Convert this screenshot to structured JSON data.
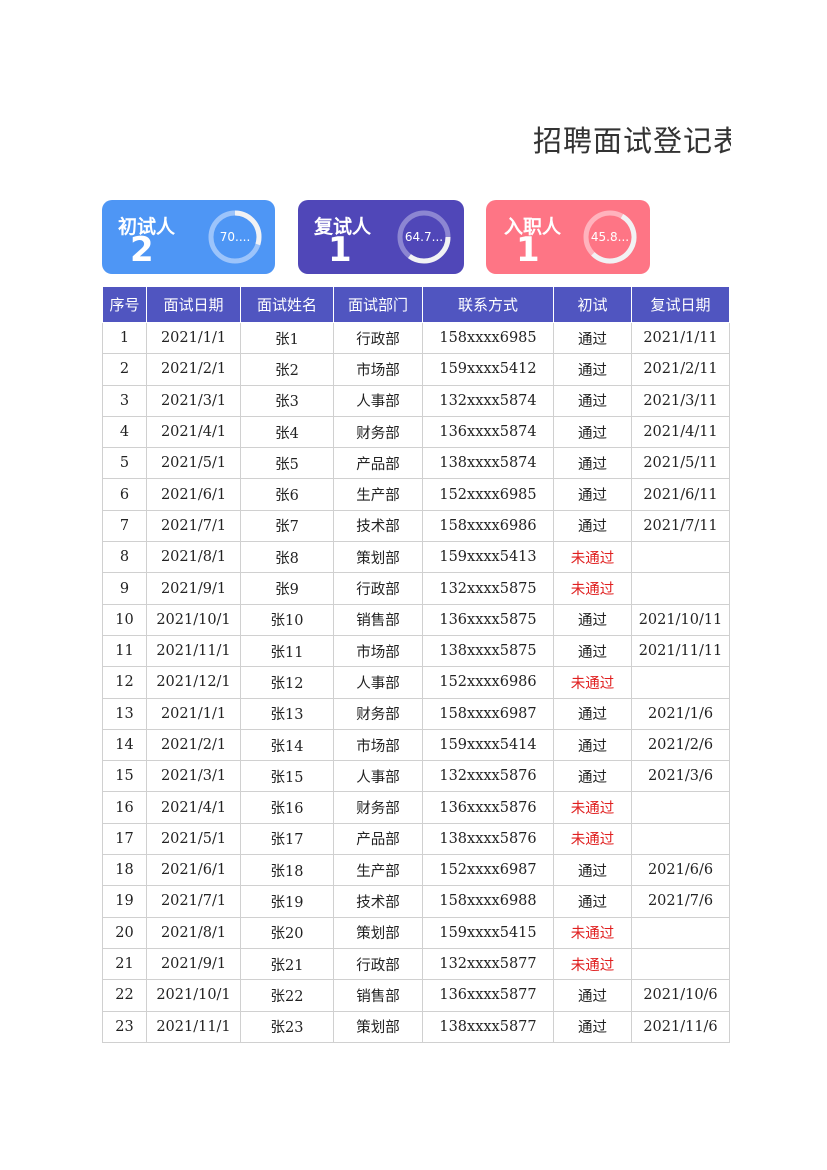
{
  "title": "招聘面试登记表",
  "cards": [
    {
      "label": "初试人",
      "count": "2",
      "ring_text": "70....",
      "percent": 70,
      "bg": "#4e96f5",
      "ring_light": "#9cc4fb"
    },
    {
      "label": "复试人",
      "count": "1",
      "ring_text": "64.7...",
      "percent": 64.7,
      "bg": "#5047b8",
      "ring_light": "#8c86d2"
    },
    {
      "label": "入职人",
      "count": "1",
      "ring_text": "45.8...",
      "percent": 45.8,
      "bg": "#fe7585",
      "ring_light": "#ffb3bd"
    }
  ],
  "table": {
    "headers": [
      "序号",
      "面试日期",
      "面试姓名",
      "面试部门",
      "联系方式",
      "初试",
      "复试日期"
    ],
    "rows": [
      [
        "1",
        "2021/1/1",
        "张1",
        "行政部",
        "158xxxx6985",
        "通过",
        "2021/1/11"
      ],
      [
        "2",
        "2021/2/1",
        "张2",
        "市场部",
        "159xxxx5412",
        "通过",
        "2021/2/11"
      ],
      [
        "3",
        "2021/3/1",
        "张3",
        "人事部",
        "132xxxx5874",
        "通过",
        "2021/3/11"
      ],
      [
        "4",
        "2021/4/1",
        "张4",
        "财务部",
        "136xxxx5874",
        "通过",
        "2021/4/11"
      ],
      [
        "5",
        "2021/5/1",
        "张5",
        "产品部",
        "138xxxx5874",
        "通过",
        "2021/5/11"
      ],
      [
        "6",
        "2021/6/1",
        "张6",
        "生产部",
        "152xxxx6985",
        "通过",
        "2021/6/11"
      ],
      [
        "7",
        "2021/7/1",
        "张7",
        "技术部",
        "158xxxx6986",
        "通过",
        "2021/7/11"
      ],
      [
        "8",
        "2021/8/1",
        "张8",
        "策划部",
        "159xxxx5413",
        "未通过",
        ""
      ],
      [
        "9",
        "2021/9/1",
        "张9",
        "行政部",
        "132xxxx5875",
        "未通过",
        ""
      ],
      [
        "10",
        "2021/10/1",
        "张10",
        "销售部",
        "136xxxx5875",
        "通过",
        "2021/10/11"
      ],
      [
        "11",
        "2021/11/1",
        "张11",
        "市场部",
        "138xxxx5875",
        "通过",
        "2021/11/11"
      ],
      [
        "12",
        "2021/12/1",
        "张12",
        "人事部",
        "152xxxx6986",
        "未通过",
        ""
      ],
      [
        "13",
        "2021/1/1",
        "张13",
        "财务部",
        "158xxxx6987",
        "通过",
        "2021/1/6"
      ],
      [
        "14",
        "2021/2/1",
        "张14",
        "市场部",
        "159xxxx5414",
        "通过",
        "2021/2/6"
      ],
      [
        "15",
        "2021/3/1",
        "张15",
        "人事部",
        "132xxxx5876",
        "通过",
        "2021/3/6"
      ],
      [
        "16",
        "2021/4/1",
        "张16",
        "财务部",
        "136xxxx5876",
        "未通过",
        ""
      ],
      [
        "17",
        "2021/5/1",
        "张17",
        "产品部",
        "138xxxx5876",
        "未通过",
        ""
      ],
      [
        "18",
        "2021/6/1",
        "张18",
        "生产部",
        "152xxxx6987",
        "通过",
        "2021/6/6"
      ],
      [
        "19",
        "2021/7/1",
        "张19",
        "技术部",
        "158xxxx6988",
        "通过",
        "2021/7/6"
      ],
      [
        "20",
        "2021/8/1",
        "张20",
        "策划部",
        "159xxxx5415",
        "未通过",
        ""
      ],
      [
        "21",
        "2021/9/1",
        "张21",
        "行政部",
        "132xxxx5877",
        "未通过",
        ""
      ],
      [
        "22",
        "2021/10/1",
        "张22",
        "销售部",
        "136xxxx5877",
        "通过",
        "2021/10/6"
      ],
      [
        "23",
        "2021/11/1",
        "张23",
        "策划部",
        "138xxxx5877",
        "通过",
        "2021/11/6"
      ]
    ],
    "fail_value": "未通过",
    "fail_color": "#e02020",
    "header_color": "#5055c0"
  }
}
